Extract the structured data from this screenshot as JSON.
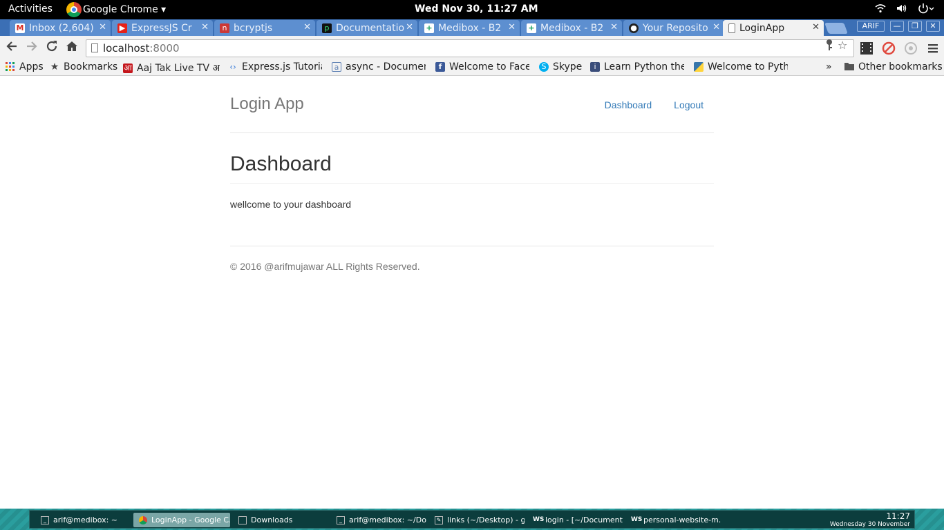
{
  "topbar": {
    "activities": "Activities",
    "app_name": "Google Chrome ▾",
    "clock": "Wed Nov 30, 11:27 AM"
  },
  "tabs": [
    {
      "label": "Inbox (2,604)",
      "icon": "gmail-icon",
      "color": "#d93025"
    },
    {
      "label": "ExpressJS Cr",
      "icon": "youtube-icon",
      "color": "#e62117"
    },
    {
      "label": "bcryptjs",
      "icon": "npm-icon",
      "color": "#cb3837"
    },
    {
      "label": "Documentatio",
      "icon": "passport-icon",
      "color": "#111111"
    },
    {
      "label": "Medibox - B2",
      "icon": "sheets-icon",
      "color": "#0f9d58"
    },
    {
      "label": "Medibox - B2",
      "icon": "sheets-icon",
      "color": "#0f9d58"
    },
    {
      "label": "Your Reposito",
      "icon": "github-icon",
      "color": "#222222"
    },
    {
      "label": "LoginApp",
      "icon": "page-icon",
      "color": "#ffffff"
    }
  ],
  "window": {
    "profile": "ARIF"
  },
  "omnibox": {
    "host": "localhost",
    "port": ":8000"
  },
  "bookmarks": {
    "apps": "Apps",
    "bookmarks": "Bookmarks",
    "items": [
      {
        "label": "Aaj Tak Live TV आ",
        "icon": "aajtak-icon"
      },
      {
        "label": "Express.js Tutoria",
        "icon": "code-icon"
      },
      {
        "label": "async - Documen",
        "icon": "async-icon"
      },
      {
        "label": "Welcome to Face",
        "icon": "facebook-icon"
      },
      {
        "label": "Skype",
        "icon": "skype-icon"
      },
      {
        "label": "Learn Python the",
        "icon": "python-book-icon"
      },
      {
        "label": "Welcome to Pyth",
        "icon": "python-icon"
      }
    ],
    "more": "»",
    "other": "Other bookmarks"
  },
  "page": {
    "brand": "Login App",
    "nav": {
      "dashboard": "Dashboard",
      "logout": "Logout"
    },
    "heading": "Dashboard",
    "message": "wellcome to your dashboard",
    "footer": "© 2016 @arifmujawar ALL Rights Reserved."
  },
  "taskbar": {
    "items": [
      {
        "label": "arif@medibox: ~",
        "icon": "terminal-icon"
      },
      {
        "label": "LoginApp - Google C...",
        "icon": "chrome-icon"
      },
      {
        "label": "Downloads",
        "icon": "folder-icon"
      },
      {
        "label": "arif@medibox: ~/Do...",
        "icon": "terminal-icon"
      },
      {
        "label": "links (~/Desktop) - g...",
        "icon": "text-editor-icon"
      },
      {
        "label": "login - [~/Document...",
        "icon": "webstorm-icon"
      },
      {
        "label": "personal-website-m...",
        "icon": "webstorm-icon"
      }
    ],
    "time": "11:27",
    "date": "Wednesday 30 November"
  }
}
